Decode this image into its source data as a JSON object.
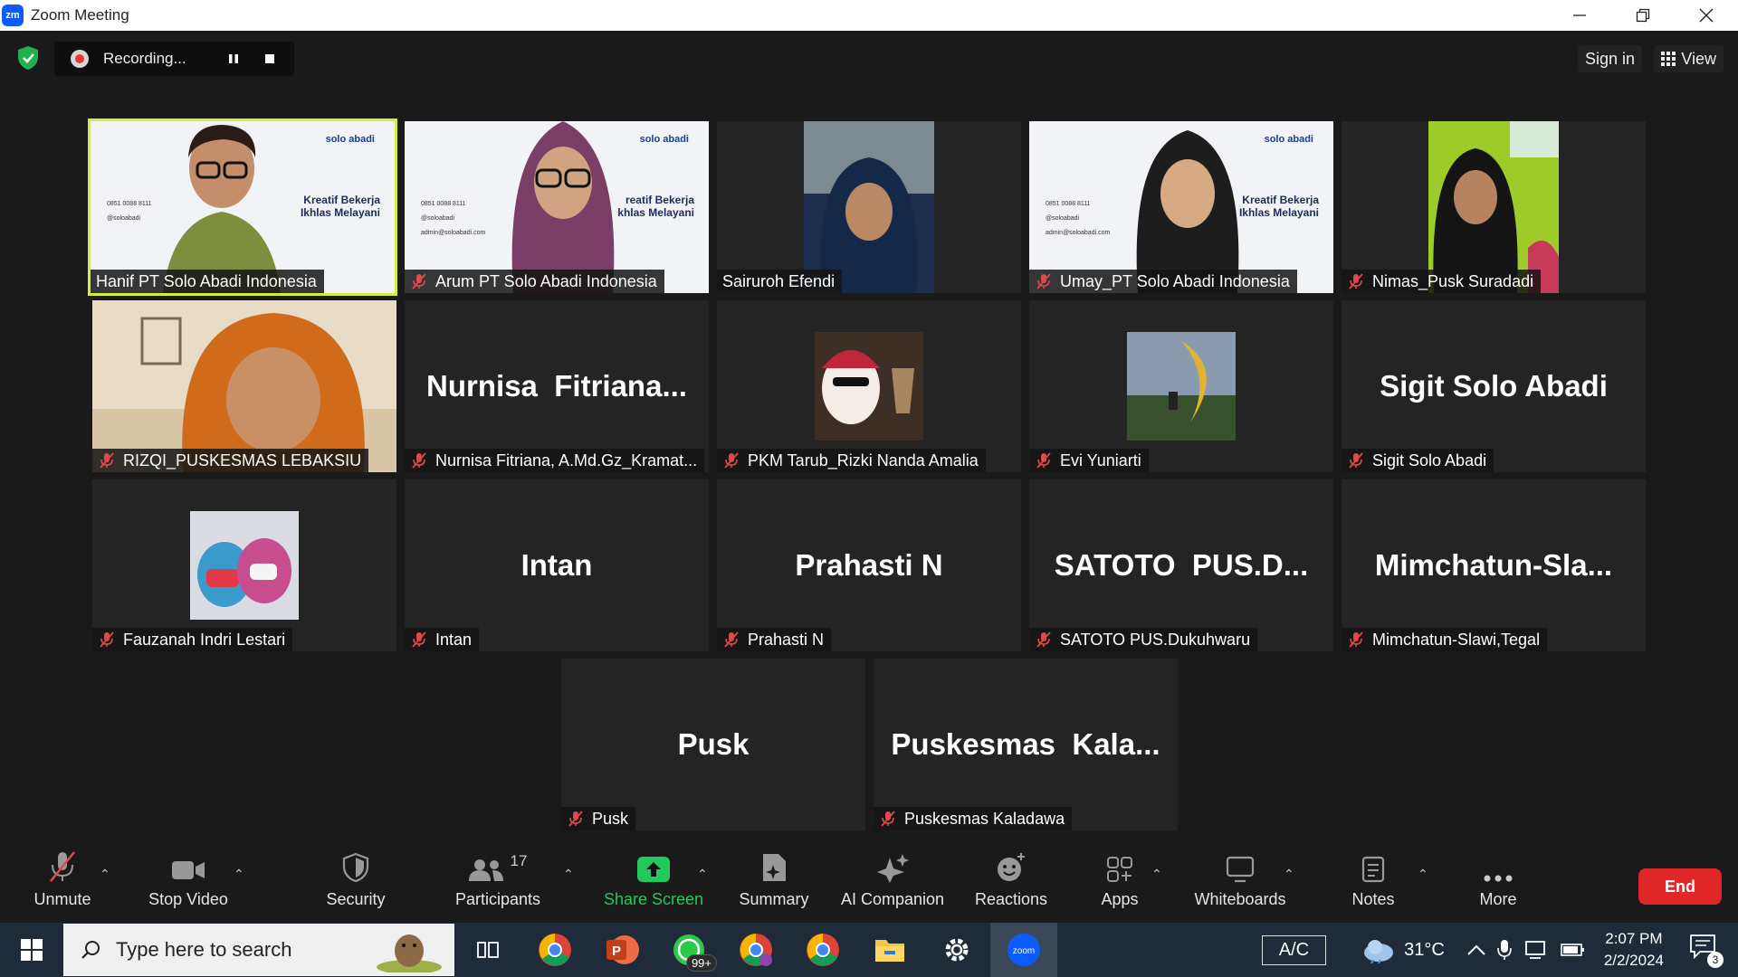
{
  "window": {
    "title": "Zoom Meeting",
    "logo_text": "zm"
  },
  "topbar": {
    "recording_label": "Recording...",
    "signin_label": "Sign in",
    "view_label": "View"
  },
  "participants": [
    {
      "name": "Hanif PT Solo Abadi Indonesia",
      "muted": false,
      "video": true,
      "active": true
    },
    {
      "name": "Arum PT Solo Abadi Indonesia",
      "muted": true,
      "video": true
    },
    {
      "name": "Sairuroh Efendi",
      "muted": false,
      "video": true
    },
    {
      "name": "Umay_PT Solo Abadi Indonesia",
      "muted": true,
      "video": true
    },
    {
      "name": "Nimas_Pusk Suradadi",
      "muted": true,
      "video": true
    },
    {
      "name": "RIZQI_PUSKESMAS LEBAKSIU",
      "muted": true,
      "video": true
    },
    {
      "name": "Nurnisa Fitriana, A.Md.Gz_Kramat...",
      "display": "Nurnisa  Fitriana...",
      "muted": true,
      "video": false
    },
    {
      "name": "PKM Tarub_Rizki Nanda Amalia",
      "muted": true,
      "video": false,
      "avatar": true
    },
    {
      "name": "Evi Yuniarti",
      "muted": true,
      "video": false,
      "avatar": true
    },
    {
      "name": "Sigit Solo Abadi",
      "display": "Sigit Solo Abadi",
      "muted": true,
      "video": false
    },
    {
      "name": "Fauzanah Indri Lestari",
      "muted": true,
      "video": false,
      "avatar": true
    },
    {
      "name": "Intan",
      "display": "Intan",
      "muted": true,
      "video": false
    },
    {
      "name": "Prahasti N",
      "display": "Prahasti N",
      "muted": true,
      "video": false
    },
    {
      "name": "SATOTO PUS.Dukuhwaru",
      "display": "SATOTO  PUS.D...",
      "muted": true,
      "video": false
    },
    {
      "name": "Mimchatun-Slawi,Tegal",
      "display": "Mimchatun-Sla...",
      "muted": true,
      "video": false
    },
    {
      "name": "Pusk",
      "display": "Pusk",
      "muted": true,
      "video": false
    },
    {
      "name": "Puskesmas Kaladawa",
      "display": "Puskesmas  Kala...",
      "muted": true,
      "video": false
    }
  ],
  "slide": {
    "logo": "solo abadi",
    "tagline_1": "Kreatif Bekerja",
    "tagline_2": "Ikhlas Melayani",
    "tagline_partial": "reatif Bekerja",
    "tagline_partial_2": "khlas Melayani",
    "phone": "0851 0088 8111",
    "handle": "@soloabadi",
    "email": "admin@soloabadi.com"
  },
  "toolbar": {
    "unmute": "Unmute",
    "stop_video": "Stop Video",
    "security": "Security",
    "participants": "Participants",
    "participants_count": "17",
    "share_screen": "Share Screen",
    "summary": "Summary",
    "ai_companion": "AI Companion",
    "reactions": "Reactions",
    "apps": "Apps",
    "whiteboards": "Whiteboards",
    "notes": "Notes",
    "more": "More",
    "end": "End"
  },
  "taskbar": {
    "search_placeholder": "Type here to search",
    "whatsapp_badge": "99+",
    "ac_label": "A/C",
    "temperature": "31°C",
    "time": "2:07 PM",
    "date": "2/2/2024",
    "notification_count": "3",
    "zoom_label": "zoom"
  },
  "colors": {
    "accent_green": "#21c95e",
    "active_speaker": "#d4ef3a",
    "end_red": "#e02828",
    "muted_red": "#e0484c"
  }
}
